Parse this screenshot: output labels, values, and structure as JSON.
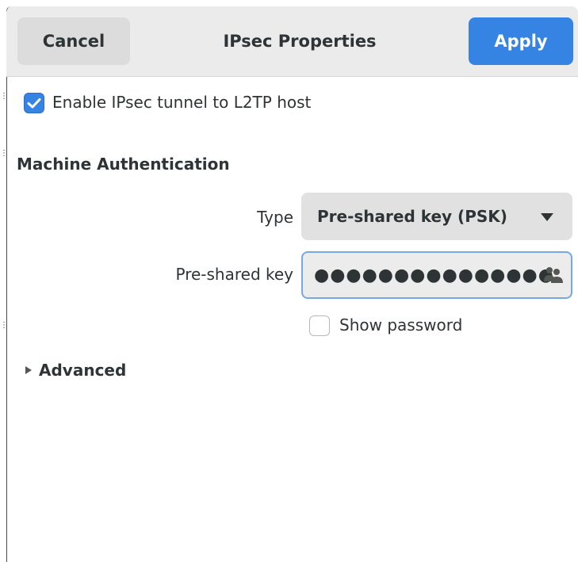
{
  "header": {
    "cancel_label": "Cancel",
    "title": "IPsec Properties",
    "apply_label": "Apply"
  },
  "ipsec": {
    "enable_label": "Enable IPsec tunnel to L2TP host",
    "enabled": true
  },
  "machine_auth": {
    "section_title": "Machine Authentication",
    "type_label": "Type",
    "type_value": "Pre-shared key (PSK)",
    "psk_label": "Pre-shared key",
    "psk_value": "●●●●●●●●●●●●●●●",
    "show_password_label": "Show password",
    "show_password_checked": false
  },
  "advanced": {
    "label": "Advanced",
    "expanded": false
  },
  "colors": {
    "accent": "#3584e4",
    "headerbar": "#ebebeb"
  },
  "icons": {
    "checkbox_checked": "checkmark-icon",
    "dropdown_arrow": "chevron-down-icon",
    "password_storage": "users-icon",
    "expander": "triangle-right-icon"
  }
}
